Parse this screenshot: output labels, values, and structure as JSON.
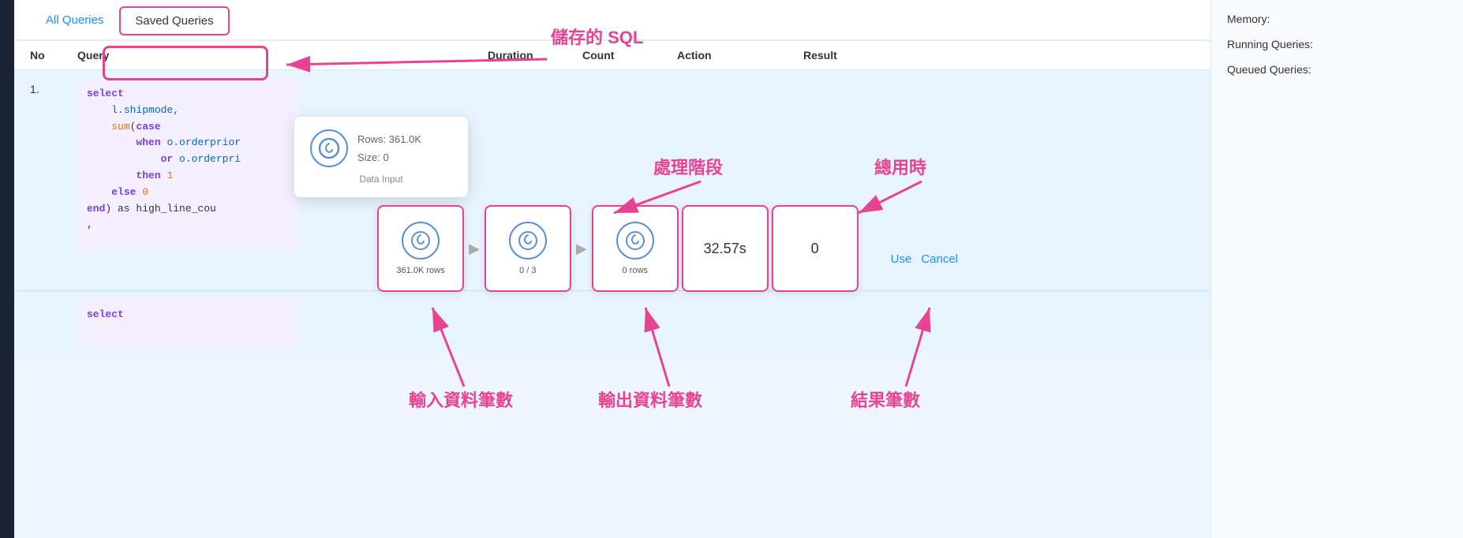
{
  "tabs": {
    "all_queries": "All Queries",
    "saved_queries": "Saved Queries"
  },
  "table": {
    "headers": [
      "No",
      "Query",
      "",
      "",
      "Duration",
      "Count",
      "Action",
      "Result"
    ],
    "row1": {
      "number": "1.",
      "sql_lines": [
        "select",
        "    l.shipmode,",
        "    sum(case",
        "        when o.orderprior",
        "            or o.orderpri",
        "        then 1",
        "    else 0",
        "end) as high_line_cou"
      ],
      "duration": "32.57s",
      "count": "0",
      "action_use": "Use",
      "action_cancel": "Cancel"
    },
    "row2": {
      "sql_start": "select"
    }
  },
  "popup": {
    "rows_label": "Rows:",
    "rows_value": "361.0K",
    "size_label": "Size:",
    "size_value": "0",
    "data_input_label": "Data Input"
  },
  "stages": {
    "box1_label": "361.0K rows",
    "box2_label": "0 / 3",
    "box3_label": "0 rows",
    "duration_value": "32.57s",
    "count_value": "0"
  },
  "annotations": {
    "saved_sql": "儲存的 SQL",
    "processing_stage": "處理階段",
    "total_time": "總用時",
    "input_rows": "輸入資料筆數",
    "output_rows": "輸出資料筆數",
    "result_rows": "結果筆數"
  },
  "right_panel": {
    "memory": "Memory:",
    "running_queries": "Running Queries:",
    "queued_queries": "Queued Queries:"
  }
}
